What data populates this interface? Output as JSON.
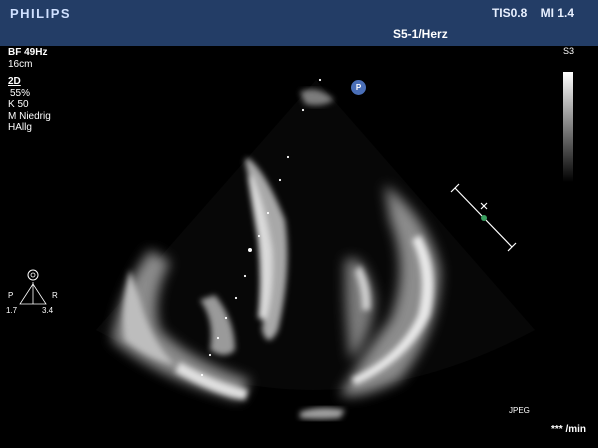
{
  "header": {
    "brand": "PHILIPS",
    "tis": "TIS0.8",
    "mi": "MI 1.4",
    "probe_preset": "S5-1/Herz"
  },
  "params": {
    "bf": "BF 49Hz",
    "depth": "16cm",
    "mode": "2D",
    "gain": "55%",
    "compression": "K 50",
    "resolution": "M Niedrig",
    "preset": "HAllg"
  },
  "scale": {
    "label": "S3"
  },
  "marker": {
    "label": "P"
  },
  "orientation": {
    "left": "P",
    "right": "R",
    "value_left": "1.7",
    "value_right": "3.4"
  },
  "footer": {
    "format": "JPEG",
    "heart_rate": "*** /min"
  },
  "colors": {
    "header_bg": "#233d66",
    "accent": "#4a6fb8",
    "caliper": "#ffffff",
    "caliper_dot": "#3aa060"
  }
}
